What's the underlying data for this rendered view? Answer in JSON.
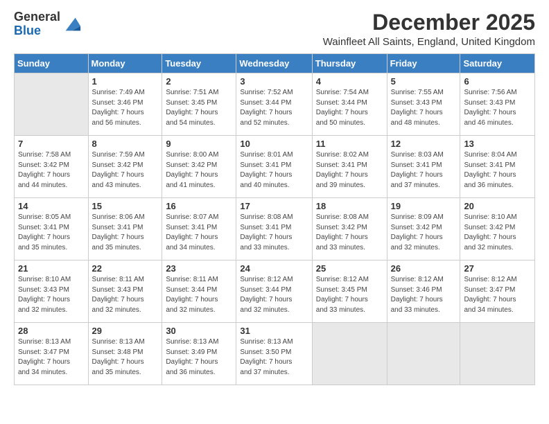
{
  "logo": {
    "general": "General",
    "blue": "Blue"
  },
  "header": {
    "month": "December 2025",
    "location": "Wainfleet All Saints, England, United Kingdom"
  },
  "weekdays": [
    "Sunday",
    "Monday",
    "Tuesday",
    "Wednesday",
    "Thursday",
    "Friday",
    "Saturday"
  ],
  "weeks": [
    [
      {
        "date": "",
        "info": ""
      },
      {
        "date": "1",
        "info": "Sunrise: 7:49 AM\nSunset: 3:46 PM\nDaylight: 7 hours\nand 56 minutes."
      },
      {
        "date": "2",
        "info": "Sunrise: 7:51 AM\nSunset: 3:45 PM\nDaylight: 7 hours\nand 54 minutes."
      },
      {
        "date": "3",
        "info": "Sunrise: 7:52 AM\nSunset: 3:44 PM\nDaylight: 7 hours\nand 52 minutes."
      },
      {
        "date": "4",
        "info": "Sunrise: 7:54 AM\nSunset: 3:44 PM\nDaylight: 7 hours\nand 50 minutes."
      },
      {
        "date": "5",
        "info": "Sunrise: 7:55 AM\nSunset: 3:43 PM\nDaylight: 7 hours\nand 48 minutes."
      },
      {
        "date": "6",
        "info": "Sunrise: 7:56 AM\nSunset: 3:43 PM\nDaylight: 7 hours\nand 46 minutes."
      }
    ],
    [
      {
        "date": "7",
        "info": "Sunrise: 7:58 AM\nSunset: 3:42 PM\nDaylight: 7 hours\nand 44 minutes."
      },
      {
        "date": "8",
        "info": "Sunrise: 7:59 AM\nSunset: 3:42 PM\nDaylight: 7 hours\nand 43 minutes."
      },
      {
        "date": "9",
        "info": "Sunrise: 8:00 AM\nSunset: 3:42 PM\nDaylight: 7 hours\nand 41 minutes."
      },
      {
        "date": "10",
        "info": "Sunrise: 8:01 AM\nSunset: 3:41 PM\nDaylight: 7 hours\nand 40 minutes."
      },
      {
        "date": "11",
        "info": "Sunrise: 8:02 AM\nSunset: 3:41 PM\nDaylight: 7 hours\nand 39 minutes."
      },
      {
        "date": "12",
        "info": "Sunrise: 8:03 AM\nSunset: 3:41 PM\nDaylight: 7 hours\nand 37 minutes."
      },
      {
        "date": "13",
        "info": "Sunrise: 8:04 AM\nSunset: 3:41 PM\nDaylight: 7 hours\nand 36 minutes."
      }
    ],
    [
      {
        "date": "14",
        "info": "Sunrise: 8:05 AM\nSunset: 3:41 PM\nDaylight: 7 hours\nand 35 minutes."
      },
      {
        "date": "15",
        "info": "Sunrise: 8:06 AM\nSunset: 3:41 PM\nDaylight: 7 hours\nand 35 minutes."
      },
      {
        "date": "16",
        "info": "Sunrise: 8:07 AM\nSunset: 3:41 PM\nDaylight: 7 hours\nand 34 minutes."
      },
      {
        "date": "17",
        "info": "Sunrise: 8:08 AM\nSunset: 3:41 PM\nDaylight: 7 hours\nand 33 minutes."
      },
      {
        "date": "18",
        "info": "Sunrise: 8:08 AM\nSunset: 3:42 PM\nDaylight: 7 hours\nand 33 minutes."
      },
      {
        "date": "19",
        "info": "Sunrise: 8:09 AM\nSunset: 3:42 PM\nDaylight: 7 hours\nand 32 minutes."
      },
      {
        "date": "20",
        "info": "Sunrise: 8:10 AM\nSunset: 3:42 PM\nDaylight: 7 hours\nand 32 minutes."
      }
    ],
    [
      {
        "date": "21",
        "info": "Sunrise: 8:10 AM\nSunset: 3:43 PM\nDaylight: 7 hours\nand 32 minutes."
      },
      {
        "date": "22",
        "info": "Sunrise: 8:11 AM\nSunset: 3:43 PM\nDaylight: 7 hours\nand 32 minutes."
      },
      {
        "date": "23",
        "info": "Sunrise: 8:11 AM\nSunset: 3:44 PM\nDaylight: 7 hours\nand 32 minutes."
      },
      {
        "date": "24",
        "info": "Sunrise: 8:12 AM\nSunset: 3:44 PM\nDaylight: 7 hours\nand 32 minutes."
      },
      {
        "date": "25",
        "info": "Sunrise: 8:12 AM\nSunset: 3:45 PM\nDaylight: 7 hours\nand 33 minutes."
      },
      {
        "date": "26",
        "info": "Sunrise: 8:12 AM\nSunset: 3:46 PM\nDaylight: 7 hours\nand 33 minutes."
      },
      {
        "date": "27",
        "info": "Sunrise: 8:12 AM\nSunset: 3:47 PM\nDaylight: 7 hours\nand 34 minutes."
      }
    ],
    [
      {
        "date": "28",
        "info": "Sunrise: 8:13 AM\nSunset: 3:47 PM\nDaylight: 7 hours\nand 34 minutes."
      },
      {
        "date": "29",
        "info": "Sunrise: 8:13 AM\nSunset: 3:48 PM\nDaylight: 7 hours\nand 35 minutes."
      },
      {
        "date": "30",
        "info": "Sunrise: 8:13 AM\nSunset: 3:49 PM\nDaylight: 7 hours\nand 36 minutes."
      },
      {
        "date": "31",
        "info": "Sunrise: 8:13 AM\nSunset: 3:50 PM\nDaylight: 7 hours\nand 37 minutes."
      },
      {
        "date": "",
        "info": ""
      },
      {
        "date": "",
        "info": ""
      },
      {
        "date": "",
        "info": ""
      }
    ]
  ]
}
